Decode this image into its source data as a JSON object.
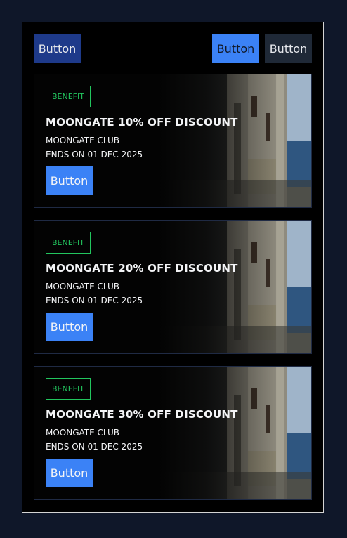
{
  "top_buttons": {
    "left_label": "Button",
    "middle_label": "Button",
    "right_label": "Button"
  },
  "cards": [
    {
      "badge": "BENEFIT",
      "title": "MOONGATE 10% OFF DISCOUNT",
      "club": "MOONGATE CLUB",
      "ends": "ENDS ON 01 DEC 2025",
      "button_label": "Button"
    },
    {
      "badge": "BENEFIT",
      "title": "MOONGATE 20% OFF DISCOUNT",
      "club": "MOONGATE CLUB",
      "ends": "ENDS ON 01 DEC 2025",
      "button_label": "Button"
    },
    {
      "badge": "BENEFIT",
      "title": "MOONGATE 30% OFF DISCOUNT",
      "club": "MOONGATE CLUB",
      "ends": "ENDS ON 01 DEC 2025",
      "button_label": "Button"
    }
  ],
  "colors": {
    "page_bg": "#0f1729",
    "panel_bg": "#000000",
    "primary": "#3b82f6",
    "primary_dark": "#1e3a8a",
    "secondary": "#1f2937",
    "badge_green": "#22c55e"
  }
}
